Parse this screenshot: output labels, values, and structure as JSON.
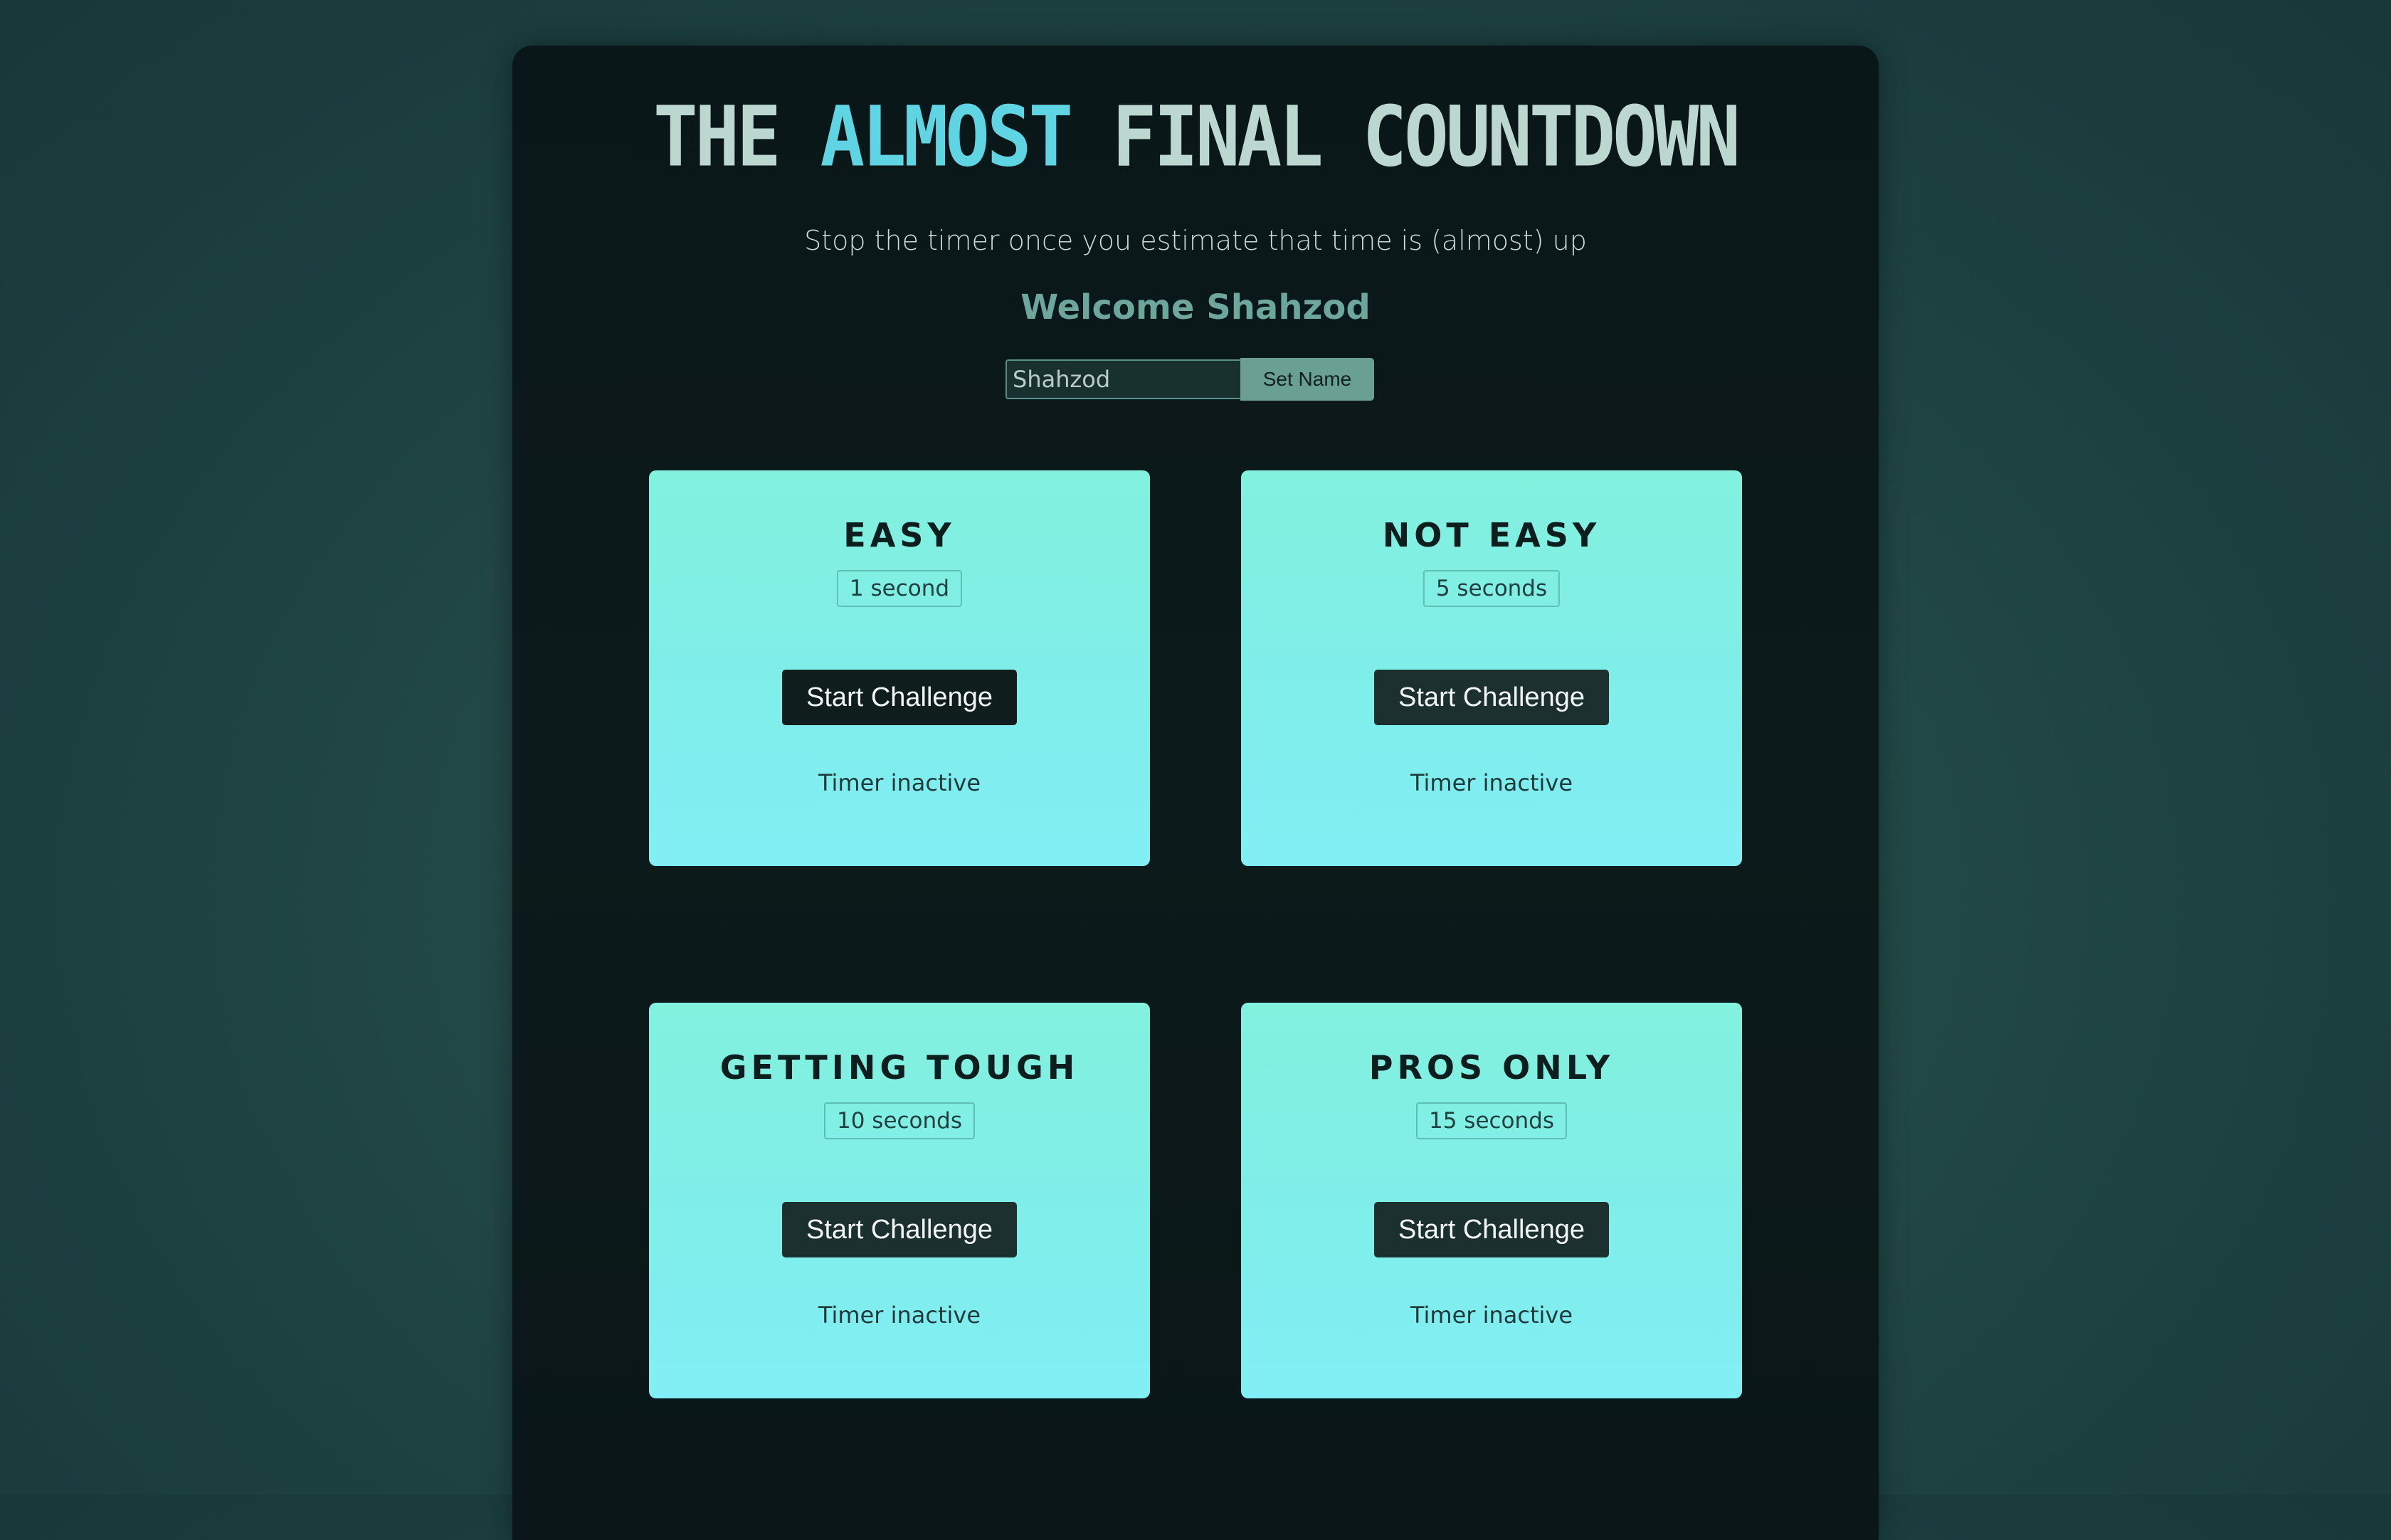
{
  "header": {
    "title_part1": "THE",
    "title_accent": "ALMOST",
    "title_part2": "FINAL COUNTDOWN",
    "subtitle": "Stop the timer once you estimate that time is (almost) up",
    "welcome": "Welcome Shahzod"
  },
  "name_form": {
    "input_value": "Shahzod",
    "button_label": "Set Name"
  },
  "challenges": [
    {
      "title": "EASY",
      "duration": "1 second",
      "button": "Start Challenge",
      "status": "Timer inactive"
    },
    {
      "title": "NOT EASY",
      "duration": "5 seconds",
      "button": "Start Challenge",
      "status": "Timer inactive"
    },
    {
      "title": "GETTING TOUGH",
      "duration": "10 seconds",
      "button": "Start Challenge",
      "status": "Timer inactive"
    },
    {
      "title": "PROS ONLY",
      "duration": "15 seconds",
      "button": "Start Challenge",
      "status": "Timer inactive"
    }
  ],
  "colors": {
    "accent": "#5fd4e2",
    "card_bg": "#81efe8",
    "button_bg": "#1d3030",
    "welcome": "#6da79c"
  }
}
